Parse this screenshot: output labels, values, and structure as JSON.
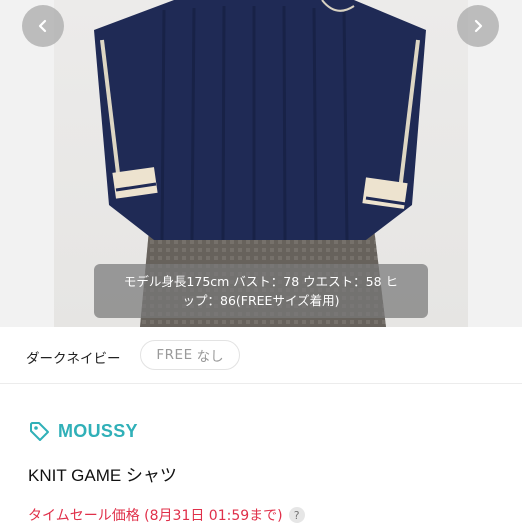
{
  "gallery": {
    "caption": "モデル身長175cm バスト：78 ウエスト：58 ヒ\nップ：86(FREEサイズ着用)",
    "prev_icon": "chevron-left-icon",
    "next_icon": "chevron-right-icon"
  },
  "variant": {
    "color_name": "ダークネイビー",
    "size": "FREE",
    "stock": "なし"
  },
  "brand": {
    "icon": "tag-icon",
    "name": "MOUSSY",
    "color": "#30b0b8"
  },
  "product": {
    "name": "KNIT GAME シャツ"
  },
  "price": {
    "sale_label": "タイムセール価格 (8月31日 01:59まで)",
    "help_icon": "question-icon",
    "sale_color": "#e0304a"
  }
}
